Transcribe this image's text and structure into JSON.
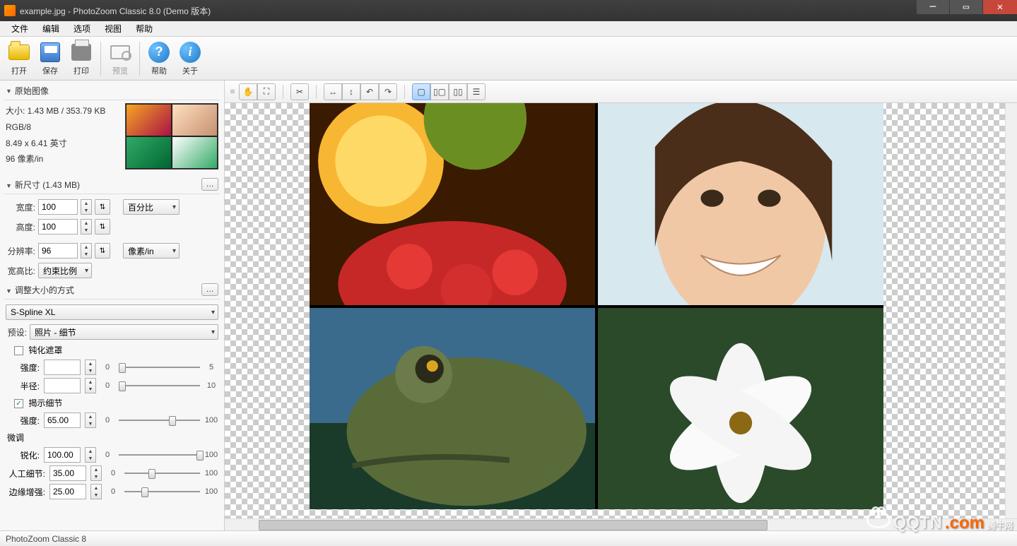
{
  "window": {
    "title": "example.jpg - PhotoZoom Classic 8.0 (Demo 版本)"
  },
  "menu": {
    "file": "文件",
    "edit": "编辑",
    "options": "选项",
    "view": "视图",
    "help": "帮助"
  },
  "toolbar": {
    "open": "打开",
    "save": "保存",
    "print": "打印",
    "preview": "预览",
    "help": "帮助",
    "about": "关于"
  },
  "sidebar": {
    "original": {
      "title": "原始图像",
      "size_line": "大小: 1.43 MB / 353.79 KB",
      "mode_line": "RGB/8",
      "dim_line": "8.49 x 6.41 英寸",
      "dpi_line": "96 像素/in"
    },
    "newsize": {
      "title": "新尺寸 (1.43 MB)",
      "width_label": "宽度:",
      "width_value": "100",
      "height_label": "高度:",
      "height_value": "100",
      "unit_percent": "百分比",
      "res_label": "分辨率:",
      "res_value": "96",
      "res_unit": "像素/in",
      "aspect_label": "宽高比:",
      "aspect_value": "约束比例"
    },
    "resize_method": {
      "title": "调整大小的方式",
      "algorithm": "S-Spline XL",
      "preset_label": "预设:",
      "preset_value": "照片 - 细节",
      "unsharp_mask": "钝化遮罩",
      "intensity_label": "强度:",
      "intensity_value": "",
      "radius_label": "半径:",
      "radius_value": "",
      "min0": "0",
      "max5": "5",
      "max10": "10",
      "max100": "100",
      "reveal_details": "揭示细节",
      "reveal_intensity_label": "强度:",
      "reveal_intensity_value": "65.00",
      "finetune": "微调",
      "sharpen_label": "锐化:",
      "sharpen_value": "100.00",
      "artifacts_label": "人工细节:",
      "artifacts_value": "35.00",
      "edge_label": "边缘增强:",
      "edge_value": "25.00"
    }
  },
  "statusbar": {
    "text": "PhotoZoom Classic 8"
  },
  "watermark": {
    "brand": "QQTN",
    "suffix": ".com",
    "cn": "腾牛网"
  }
}
